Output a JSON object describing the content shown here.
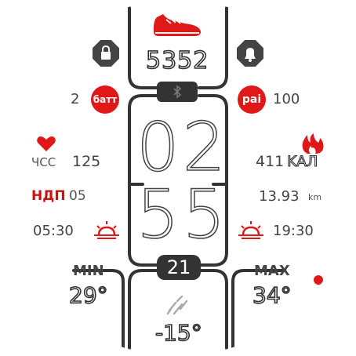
{
  "steps": {
    "value": "5352",
    "icon": "sneaker-icon"
  },
  "battery": {
    "value": "2",
    "badge": "батт"
  },
  "pai": {
    "value": "100",
    "badge": "pai"
  },
  "heart_rate": {
    "label": "ЧСС",
    "value": "125",
    "icon": "heart-icon"
  },
  "calories": {
    "value": "411",
    "unit": "KAЛ",
    "icon": "flame-icon"
  },
  "weekday": {
    "label": "НДП",
    "value": "05"
  },
  "distance": {
    "value": "13.93",
    "unit": "km"
  },
  "sunrise": {
    "time": "05:30",
    "icon": "sunrise-icon"
  },
  "sunset": {
    "time": "19:30",
    "icon": "sunset-icon"
  },
  "time": {
    "hours": "02",
    "minutes": "55"
  },
  "date": {
    "day": "21"
  },
  "weather": {
    "min_label": "MIN",
    "min_value": "29°",
    "max_label": "MAX",
    "max_value": "34°",
    "current": "-15°",
    "icon": "rain-icon"
  },
  "status": {
    "lock_icon": "lock-icon",
    "bell_icon": "bell-icon",
    "bluetooth_icon": "bluetooth-icon"
  },
  "colors": {
    "accent": "#e01818",
    "frame": "#333333",
    "text": "#555555"
  }
}
